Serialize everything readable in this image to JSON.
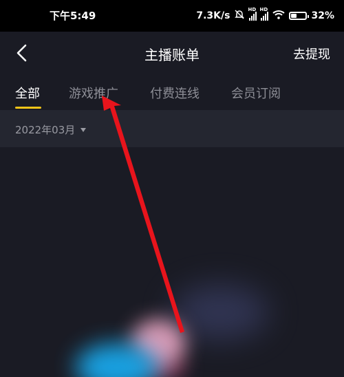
{
  "status_bar": {
    "time": "下午5:49",
    "network_speed": "7.3K/s",
    "signal_hd_label": "HD",
    "battery_percent": "32%",
    "battery_level": 0.32
  },
  "header": {
    "title": "主播账单",
    "withdraw_label": "去提现"
  },
  "tabs": [
    {
      "label": "全部",
      "active": true
    },
    {
      "label": "游戏推广",
      "active": false
    },
    {
      "label": "付费连线",
      "active": false
    },
    {
      "label": "会员订阅",
      "active": false
    }
  ],
  "filter": {
    "month": "2022年03月"
  },
  "colors": {
    "background": "#1a1b24",
    "filter_bar": "#242630",
    "tab_active_underline": "#f5c518",
    "annotation_arrow": "#e8141c"
  },
  "icons": {
    "back": "chevron-left-icon",
    "dropdown": "caret-down-icon",
    "mute": "bell-mute-icon",
    "wifi": "wifi-icon",
    "battery": "battery-icon"
  }
}
